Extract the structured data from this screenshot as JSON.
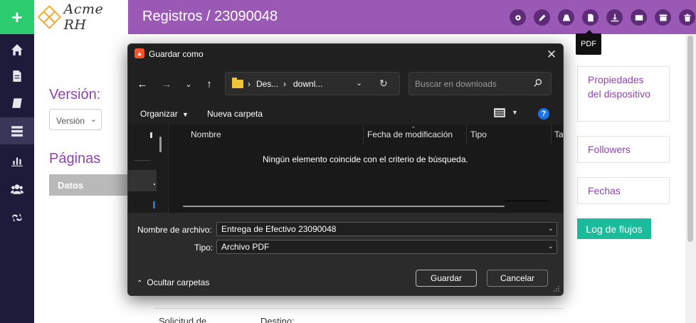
{
  "sidebar": {
    "add_label": "+",
    "items": [
      {
        "icon": "home-icon"
      },
      {
        "icon": "document-icon"
      },
      {
        "icon": "book-icon"
      },
      {
        "icon": "list-icon"
      },
      {
        "icon": "bar-chart-icon"
      },
      {
        "icon": "users-icon"
      },
      {
        "icon": "link-icon"
      }
    ]
  },
  "logo": {
    "text": "Acme RH"
  },
  "header": {
    "title": "Registros / 23090048",
    "buttons": [
      "gear-icon",
      "pencil-icon",
      "road-icon",
      "file-pdf-icon",
      "download-icon",
      "envelope-icon",
      "archive-icon",
      "trash-icon"
    ],
    "tooltip": "PDF"
  },
  "page": {
    "version_label": "Versión:",
    "version_select": "Versión",
    "paginas_label": "Páginas",
    "datos_tab": "Datos",
    "bottom_left": "Solicitud de",
    "bottom_right": "Destino:"
  },
  "right_panel": {
    "propiedades": "Propiedades del dispositivo",
    "followers": "Followers",
    "fechas": "Fechas",
    "log": "Log de flujos"
  },
  "dialog": {
    "title": "Guardar como",
    "breadcrumb": [
      "Des...",
      "downl..."
    ],
    "search_placeholder": "Buscar en downloads",
    "organize": "Organizar",
    "new_folder": "Nueva carpeta",
    "columns": [
      "Nombre",
      "Fecha de modificación",
      "Tipo",
      "Ta"
    ],
    "empty_message": "Ningún elemento coincide con el criterio de búsqueda.",
    "filename_label": "Nombre de archivo:",
    "filename_value": "Entrega de Efectivo 23090048",
    "type_label": "Tipo:",
    "type_value": "Archivo PDF",
    "hide_folders": "Ocultar carpetas",
    "save": "Guardar",
    "cancel": "Cancelar"
  },
  "colors": {
    "header": "#9b59b6",
    "sidebar": "#1e1b3a",
    "add_button": "#2ecc71",
    "accent_purple": "#8e44ad",
    "log_button": "#1abc9c"
  }
}
